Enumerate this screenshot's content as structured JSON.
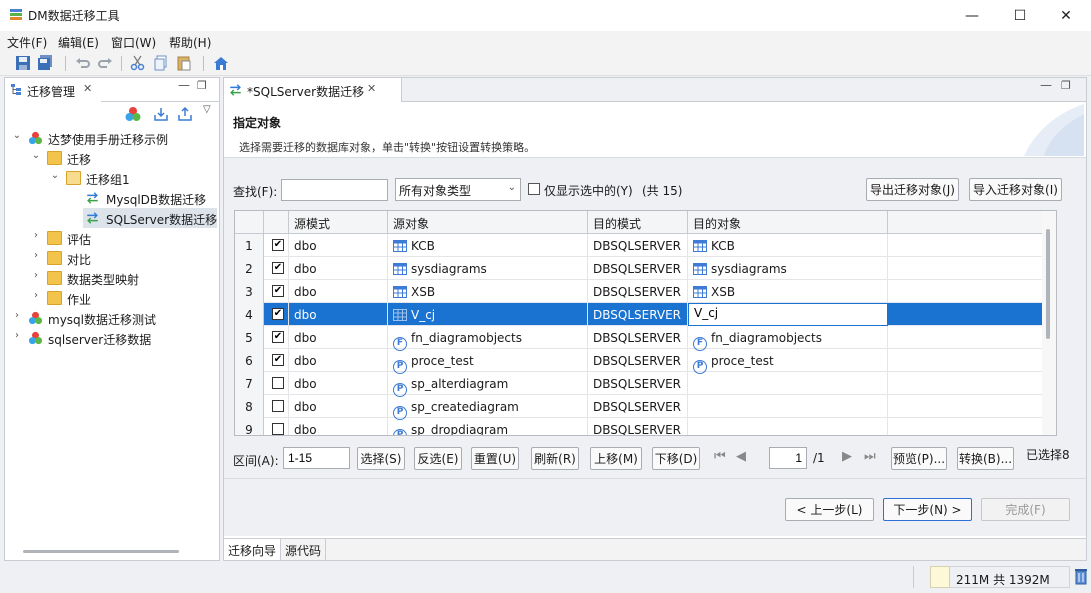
{
  "window": {
    "title": "DM数据迁移工具",
    "minimize": "—",
    "maximize": "☐",
    "close": "✕"
  },
  "menu": [
    "文件(F)",
    "编辑(E)",
    "窗口(W)",
    "帮助(H)"
  ],
  "left_panel": {
    "tab_label": "迁移管理",
    "tab_close": "✕",
    "tree": [
      {
        "label": "达梦使用手册迁移示例",
        "expanded": true,
        "icon": "project-icon"
      },
      {
        "label": "迁移",
        "expanded": true,
        "icon": "folder-icon"
      },
      {
        "label": "迁移组1",
        "expanded": true,
        "icon": "folder-icon"
      },
      {
        "label": "MysqlDB数据迁移",
        "icon": "migration-icon"
      },
      {
        "label": "SQLServer数据迁移",
        "icon": "migration-icon",
        "selected": true
      },
      {
        "label": "评估",
        "icon": "folder-icon"
      },
      {
        "label": "对比",
        "icon": "folder-icon"
      },
      {
        "label": "数据类型映射",
        "icon": "folder-icon"
      },
      {
        "label": "作业",
        "icon": "folder-icon"
      },
      {
        "label": "mysql数据迁移测试",
        "icon": "project-icon"
      },
      {
        "label": "sqlserver迁移数据",
        "icon": "project-icon"
      }
    ]
  },
  "editor": {
    "tab_label": "*SQLServer数据迁移",
    "tab_close": "✕",
    "heading": "指定对象",
    "description": "选择需要迁移的数据库对象，单击\"转换\"按钮设置转换策略。",
    "find_label": "查找(F):",
    "find_value": "",
    "type_filter": "所有对象类型",
    "only_selected_label": "仅显示选中的(Y)",
    "count_text": "(共 15)",
    "export_button": "导出迁移对象(J)",
    "import_button": "导入迁移对象(I)",
    "columns": [
      "源模式",
      "源对象",
      "目的模式",
      "目的对象"
    ],
    "rows": [
      {
        "num": "1",
        "checked": true,
        "src_schema": "dbo",
        "src_obj": "KCB",
        "src_type": "table",
        "dst_schema": "DBSQLSERVER",
        "dst_obj": "KCB",
        "dst_type": "table"
      },
      {
        "num": "2",
        "checked": true,
        "src_schema": "dbo",
        "src_obj": "sysdiagrams",
        "src_type": "table",
        "dst_schema": "DBSQLSERVER",
        "dst_obj": "sysdiagrams",
        "dst_type": "table"
      },
      {
        "num": "3",
        "checked": true,
        "src_schema": "dbo",
        "src_obj": "XSB",
        "src_type": "table",
        "dst_schema": "DBSQLSERVER",
        "dst_obj": "XSB",
        "dst_type": "table"
      },
      {
        "num": "4",
        "checked": true,
        "src_schema": "dbo",
        "src_obj": "V_cj",
        "src_type": "view",
        "dst_schema": "DBSQLSERVER",
        "dst_obj": "V_cj",
        "dst_type": "edit",
        "selected": true
      },
      {
        "num": "5",
        "checked": true,
        "src_schema": "dbo",
        "src_obj": "fn_diagramobjects",
        "src_type": "function",
        "dst_schema": "DBSQLSERVER",
        "dst_obj": "fn_diagramobjects",
        "dst_type": "function"
      },
      {
        "num": "6",
        "checked": true,
        "src_schema": "dbo",
        "src_obj": "proce_test",
        "src_type": "procedure",
        "dst_schema": "DBSQLSERVER",
        "dst_obj": "proce_test",
        "dst_type": "procedure"
      },
      {
        "num": "7",
        "checked": false,
        "src_schema": "dbo",
        "src_obj": "sp_alterdiagram",
        "src_type": "procedure",
        "dst_schema": "DBSQLSERVER",
        "dst_obj": "",
        "dst_type": ""
      },
      {
        "num": "8",
        "checked": false,
        "src_schema": "dbo",
        "src_obj": "sp_creatediagram",
        "src_type": "procedure",
        "dst_schema": "DBSQLSERVER",
        "dst_obj": "",
        "dst_type": ""
      },
      {
        "num": "9",
        "checked": false,
        "src_schema": "dbo",
        "src_obj": "sp_dropdiagram",
        "src_type": "procedure",
        "dst_schema": "DBSQLSERVER",
        "dst_obj": "",
        "dst_type": ""
      }
    ],
    "range_label": "区间(A):",
    "range_value": "1-15",
    "buttons": {
      "select": "选择(S)",
      "invert": "反选(E)",
      "reset": "重置(U)",
      "refresh": "刷新(R)",
      "move_up": "上移(M)",
      "move_down": "下移(D)",
      "preview": "预览(P)...",
      "convert": "转换(B)..."
    },
    "page_value": "1",
    "page_total": "/1",
    "selected_count": "已选择8",
    "wizard": {
      "prev": "< 上一步(L)",
      "next": "下一步(N) >",
      "finish": "完成(F)"
    },
    "bottom_tabs": [
      "迁移向导",
      "源代码"
    ]
  },
  "status": {
    "memory": "211M 共 1392M"
  }
}
